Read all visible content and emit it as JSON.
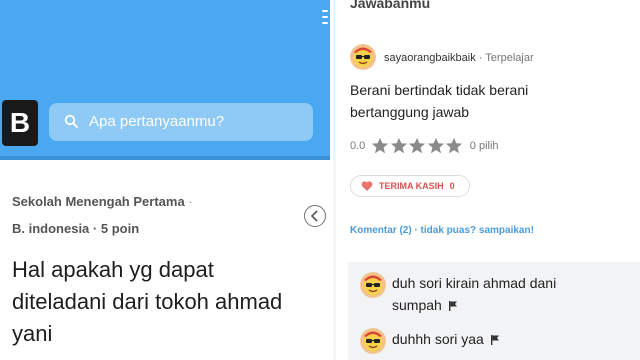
{
  "left_panel": {
    "logo_letter": "B",
    "search_placeholder": "Apa pertanyaanmu?",
    "subject_level": "Sekolah Menengah Pertama",
    "subject_sep": "·",
    "subject_name": "B. indonesia",
    "subject_points": "· 5 poin",
    "question": "Hal apakah yg dapat\nditeladani dari tokoh ahmad\nyani",
    "colors": {
      "header_blue": "#4aa8f0",
      "search_bg": "#8fcaf6"
    }
  },
  "right_panel": {
    "section_title": "Jawabanmu",
    "username": "sayaorangbaikbaik",
    "rank": " · Terpelajar",
    "answer": "Berani bertindak tidak berani bertanggung jawab",
    "rating_value": "0.0",
    "rating_count": "0 pilih",
    "thanks_label": "TERIMA KASIH",
    "thanks_count": "0",
    "comments_link": "Komentar (2) · tidak puas? sampaikan!",
    "comments": [
      {
        "text": "duh sori kirain ahmad dani sumpah"
      },
      {
        "text": "duhhh sori yaa"
      }
    ],
    "icons": [
      "avatar",
      "star-icon",
      "heart-icon",
      "flag-icon"
    ],
    "colors": {
      "link_blue": "#4a9bd9",
      "thanks_red": "#d9534f",
      "star_gray": "#8a8a8a"
    }
  }
}
